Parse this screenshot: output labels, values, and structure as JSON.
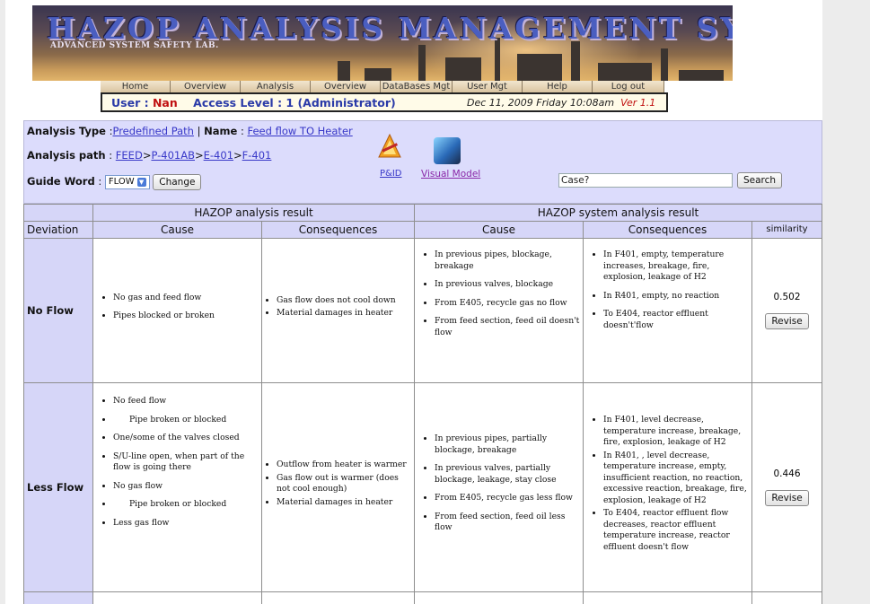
{
  "banner": {
    "title": "HAZOP ANALYSIS MANAGEMENT SYSTEM",
    "subtitle": "ADVANCED SYSTEM SAFETY LAB."
  },
  "nav": [
    {
      "label": "Home"
    },
    {
      "label": "Overview"
    },
    {
      "label": "Analysis"
    },
    {
      "label": "Overview"
    },
    {
      "label": "DataBases Mgt"
    },
    {
      "label": "User Mgt"
    },
    {
      "label": "Help"
    },
    {
      "label": "Log out"
    }
  ],
  "userbar": {
    "user_label": "User : ",
    "user_name": "Nan",
    "access_label": "Access Level : 1 (Administrator)",
    "date": "Dec 11, 2009 Friday 10:08am",
    "version": "Ver 1.1"
  },
  "analysis": {
    "type_label": "Analysis Type",
    "type_value": "Predefined Path",
    "name_label": "Name",
    "name_value": "Feed flow TO Heater",
    "path_label": "Analysis path",
    "path_parts": [
      "FEED",
      "P-401AB",
      "E-401",
      "F-401"
    ],
    "guide_label": "Guide Word",
    "guide_value": "FLOW",
    "change_button": "Change",
    "pid_label": "P&ID",
    "visual_model_label": "Visual Model",
    "case_placeholder": "Case?",
    "search_button": "Search"
  },
  "table": {
    "header_left": "HAZOP analysis result",
    "header_right": "HAZOP system analysis result",
    "col_deviation": "Deviation",
    "col_cause": "Cause",
    "col_consequences": "Consequences",
    "col_cause2": "Cause",
    "col_consequences2": "Consequences",
    "col_similarity": "similarity",
    "rows": [
      {
        "deviation": "No Flow",
        "cause": [
          "No gas and feed flow",
          "Pipes blocked or broken"
        ],
        "consequences": [
          "Gas flow does not cool down",
          "Material damages in heater"
        ],
        "sys_cause": [
          "In previous pipes, blockage, breakage",
          "In previous valves, blockage",
          "From E405, recycle gas no flow",
          "From feed section, feed oil doesn't flow"
        ],
        "sys_consequences": [
          "In F401, empty, temperature increases, breakage, fire, explosion, leakage of H2",
          "In R401, empty,  no reaction",
          "To E404, reactor effluent doesn't'flow"
        ],
        "similarity": "0.502",
        "revise": "Revise"
      },
      {
        "deviation": "Less Flow",
        "cause": [
          "No feed flow",
          "Pipe broken or blocked",
          "One/some of the valves closed",
          "S/U-line open, when part of the flow is going there",
          "No gas flow",
          "Pipe broken or blocked",
          "Less gas flow"
        ],
        "consequences": [
          "Outflow from heater is warmer",
          "Gas flow out is warmer (does not cool enough)",
          "Material damages in heater"
        ],
        "sys_cause": [
          "In previous pipes, partially blockage, breakage",
          "In previous valves, partially blockage, leakage, stay close",
          "From E405, recycle gas less flow",
          "From feed section, feed oil less flow"
        ],
        "sys_consequences": [
          "In F401, level decrease, temperature increase, breakage, fire, explosion, leakage of H2",
          "In R401, , level decrease, temperature increase, empty, insufficient reaction,  no reaction, excessive reaction, breakage, fire, explosion, leakage of H2",
          "To E404, reactor effluent flow decreases, reactor effluent temperature increase, reactor effluent doesn't flow"
        ],
        "similarity": "0.446",
        "revise": "Revise"
      }
    ]
  }
}
